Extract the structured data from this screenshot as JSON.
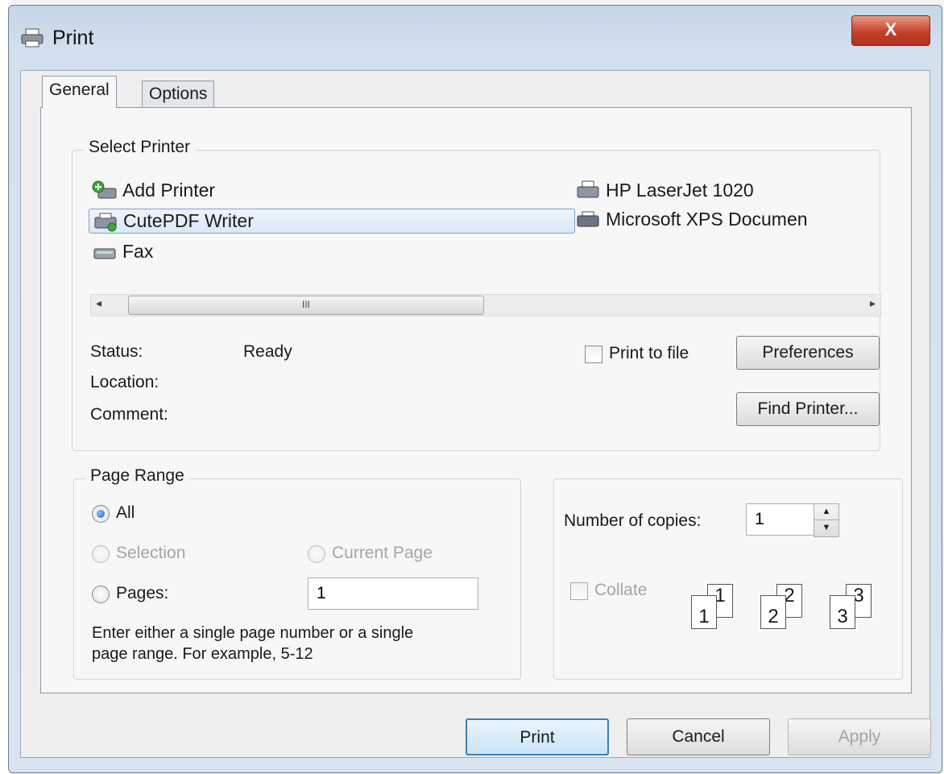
{
  "window": {
    "title": "Print",
    "close_label": "X"
  },
  "tabs": [
    {
      "label": "General"
    },
    {
      "label": "Options"
    }
  ],
  "select_printer": {
    "group_label": "Select Printer",
    "printers": [
      {
        "name": "Add Printer",
        "icon": "add-printer-icon"
      },
      {
        "name": "CutePDF Writer",
        "icon": "printer-icon",
        "selected": true
      },
      {
        "name": "Fax",
        "icon": "fax-icon"
      },
      {
        "name": "HP LaserJet 1020",
        "icon": "printer-icon"
      },
      {
        "name": "Microsoft XPS Documen",
        "icon": "printer-icon"
      }
    ],
    "scroll_thumb": "III",
    "status_label": "Status:",
    "status_value": "Ready",
    "location_label": "Location:",
    "comment_label": "Comment:",
    "print_to_file_label": "Print to file",
    "print_to_file_checked": false,
    "preferences_label": "Preferences",
    "find_printer_label": "Find Printer..."
  },
  "page_range": {
    "group_label": "Page Range",
    "all_label": "All",
    "selection_label": "Selection",
    "current_page_label": "Current Page",
    "pages_label": "Pages:",
    "pages_value": "1",
    "hint_line1": "Enter either a single page number or a single",
    "hint_line2": "page range.  For example, 5-12",
    "selected_option": "All"
  },
  "copies": {
    "label": "Number of copies:",
    "value": "1",
    "collate_label": "Collate",
    "collate_checked": false,
    "collate_pages": [
      "1",
      "2",
      "3"
    ]
  },
  "footer": {
    "print_label": "Print",
    "cancel_label": "Cancel",
    "apply_label": "Apply"
  }
}
